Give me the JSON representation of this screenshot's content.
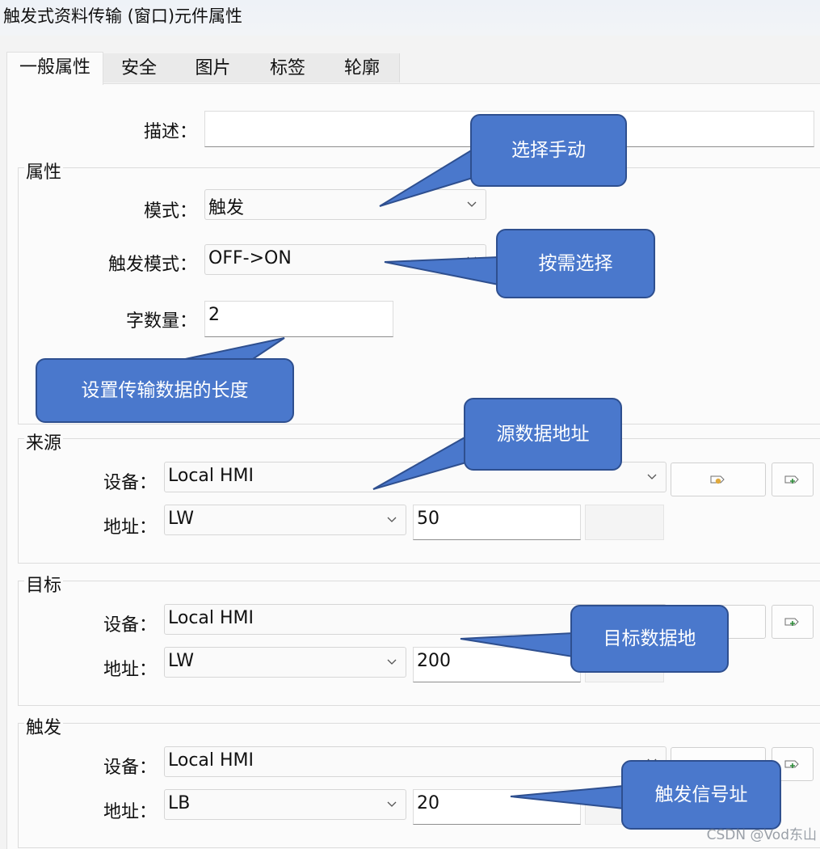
{
  "window": {
    "title": "触发式资料传输 (窗口)元件属性"
  },
  "tabs": [
    "一般属性",
    "安全",
    "图片",
    "标签",
    "轮廓"
  ],
  "general": {
    "description_label": "描述：",
    "description_value": ""
  },
  "properties": {
    "group_title": "属性",
    "mode_label": "模式：",
    "mode_value": "触发",
    "trigger_mode_label": "触发模式：",
    "trigger_mode_value": "OFF->ON",
    "word_count_label": "字数量：",
    "word_count_value": "2"
  },
  "source": {
    "group_title": "来源",
    "device_label": "设备：",
    "device_value": "Local HMI",
    "address_label": "地址：",
    "address_type": "LW",
    "address_value": "50"
  },
  "target": {
    "group_title": "目标",
    "device_label": "设备：",
    "device_value": "Local HMI",
    "address_label": "地址：",
    "address_type": "LW",
    "address_value": "200"
  },
  "trigger": {
    "group_title": "触发",
    "device_label": "设备：",
    "device_value": "Local HMI",
    "address_label": "地址：",
    "address_type": "LB",
    "address_value": "20"
  },
  "callouts": {
    "select_manual": "选择手动",
    "select_as_needed": "按需选择",
    "set_length": "设置传输数据的长度",
    "source_address": "源数据地址",
    "target_address": "目标数据地",
    "trigger_address": "触发信号址"
  },
  "watermark": "CSDN @Vod东山",
  "colors": {
    "callout_fill": "#4a78cc",
    "callout_border": "#2e4f8f",
    "panel_bg": "#fbfbfb"
  }
}
